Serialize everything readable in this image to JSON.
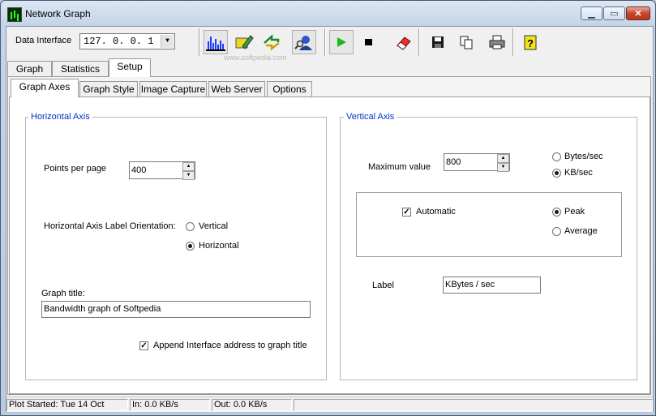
{
  "window": {
    "title": "Network Graph"
  },
  "toolbar": {
    "interface_label": "Data Interface",
    "interface_value": "127. 0. 0. 1"
  },
  "main_tabs": [
    {
      "label": "Graph"
    },
    {
      "label": "Statistics"
    },
    {
      "label": "Setup"
    }
  ],
  "sub_tabs": [
    {
      "label": "Graph Axes"
    },
    {
      "label": "Graph Style"
    },
    {
      "label": "Image Capture"
    },
    {
      "label": "Web Server"
    },
    {
      "label": "Options"
    }
  ],
  "horizontal": {
    "title": "Horizontal Axis",
    "points_label": "Points per page",
    "points_value": "400",
    "orientation_label": "Horizontal Axis Label Orientation:",
    "vertical_option": "Vertical",
    "horizontal_option": "Horizontal",
    "graph_title_label": "Graph title:",
    "graph_title_value": "Bandwidth graph of Softpedia",
    "append_label": "Append Interface address to graph title"
  },
  "vertical": {
    "title": "Vertical Axis",
    "max_label": "Maximum value",
    "max_value": "800",
    "bytes_option": "Bytes/sec",
    "kb_option": "KB/sec",
    "automatic_label": "Automatic",
    "peak_option": "Peak",
    "average_option": "Average",
    "label_label": "Label",
    "label_value": "KBytes / sec"
  },
  "status": {
    "started": "Plot Started: Tue 14 Oct",
    "in": "In: 0.0 KB/s",
    "out": "Out: 0.0 KB/s"
  },
  "watermark": "www.softpedia.com",
  "colors": {
    "group_title": "#0033cc",
    "play": "#1fb51f",
    "window_frame": "#bfcde0"
  }
}
